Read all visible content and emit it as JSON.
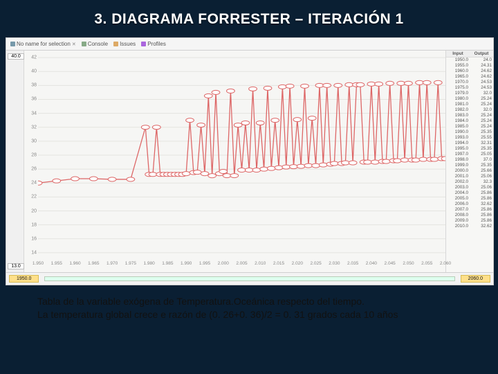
{
  "slide": {
    "title": "3. DIAGRAMA FORRESTER – ITERACIÓN 1"
  },
  "toolbar": {
    "tab1": "No name for selection",
    "console": "Console",
    "issues": "Issues",
    "profiles": "Profiles"
  },
  "edge": {
    "top_left": "40.0",
    "bottom_left": "13.0"
  },
  "slider": {
    "start": "1950.0",
    "end": "2060.0"
  },
  "table_head": {
    "input": "Input",
    "output": "Output"
  },
  "caption": {
    "l1": "Tabla de la variable exógena de Temperatura.Oceánica respecto del tiempo.",
    "l2": "La temperatura global crece e razón de (0. 26+0. 36)/2 = 0. 31 grados cada 10 años"
  },
  "chart_data": {
    "type": "line",
    "title": "",
    "xlabel": "",
    "ylabel": "",
    "xlim": [
      1950,
      2060
    ],
    "ylim": [
      13,
      43
    ],
    "y_ticks": [
      14,
      16,
      18,
      20,
      22,
      24,
      26,
      28,
      30,
      32,
      34,
      36,
      38,
      40,
      42
    ],
    "x_ticks": [
      1950,
      1955,
      1960,
      1965,
      1970,
      1975,
      1980,
      1985,
      1990,
      1995,
      2000,
      2005,
      2010,
      2015,
      2020,
      2025,
      2030,
      2035,
      2040,
      2045,
      2050,
      2055,
      2060
    ],
    "series": [
      {
        "name": "Temperatura.Oceánica",
        "points": [
          [
            1950,
            24.0
          ],
          [
            1955,
            24.31
          ],
          [
            1960,
            24.62
          ],
          [
            1965,
            24.62
          ],
          [
            1970,
            24.53
          ],
          [
            1975,
            24.53
          ],
          [
            1979,
            32.0
          ],
          [
            1980,
            25.24
          ],
          [
            1981,
            25.24
          ],
          [
            1982,
            32.0
          ],
          [
            1983,
            25.24
          ],
          [
            1984,
            25.24
          ],
          [
            1985,
            25.24
          ],
          [
            1986,
            25.24
          ],
          [
            1987,
            25.24
          ],
          [
            1988,
            25.24
          ],
          [
            1989,
            25.24
          ],
          [
            1990,
            25.35
          ],
          [
            1991,
            33.0
          ],
          [
            1992,
            25.5
          ],
          [
            1993,
            25.55
          ],
          [
            1994,
            32.31
          ],
          [
            1995,
            25.35
          ],
          [
            1996,
            36.5
          ],
          [
            1997,
            25.05
          ],
          [
            1998,
            37.0
          ],
          [
            1999,
            25.35
          ],
          [
            2000,
            25.66
          ],
          [
            2001,
            25.06
          ],
          [
            2002,
            37.2
          ],
          [
            2003,
            25.06
          ],
          [
            2004,
            32.31
          ],
          [
            2005,
            25.86
          ],
          [
            2006,
            32.62
          ],
          [
            2007,
            25.86
          ],
          [
            2008,
            37.5
          ],
          [
            2009,
            25.86
          ],
          [
            2010,
            32.62
          ],
          [
            2011,
            26.0
          ],
          [
            2012,
            37.6
          ],
          [
            2013,
            26.1
          ],
          [
            2014,
            33.0
          ],
          [
            2015,
            26.2
          ],
          [
            2016,
            37.8
          ],
          [
            2017,
            26.3
          ],
          [
            2018,
            37.9
          ],
          [
            2019,
            26.35
          ],
          [
            2020,
            33.1
          ],
          [
            2021,
            26.4
          ],
          [
            2022,
            37.9
          ],
          [
            2023,
            26.5
          ],
          [
            2024,
            33.3
          ],
          [
            2025,
            26.5
          ],
          [
            2026,
            38.0
          ],
          [
            2027,
            26.6
          ],
          [
            2028,
            38.0
          ],
          [
            2029,
            26.7
          ],
          [
            2030,
            26.8
          ],
          [
            2031,
            38.0
          ],
          [
            2032,
            26.8
          ],
          [
            2033,
            26.9
          ],
          [
            2034,
            38.1
          ],
          [
            2035,
            26.9
          ],
          [
            2036,
            38.1
          ],
          [
            2037,
            38.1
          ],
          [
            2038,
            27.0
          ],
          [
            2039,
            27.0
          ],
          [
            2040,
            38.2
          ],
          [
            2041,
            27.0
          ],
          [
            2042,
            38.2
          ],
          [
            2043,
            27.1
          ],
          [
            2044,
            27.1
          ],
          [
            2045,
            38.3
          ],
          [
            2046,
            27.2
          ],
          [
            2047,
            27.2
          ],
          [
            2048,
            38.3
          ],
          [
            2049,
            27.3
          ],
          [
            2050,
            38.3
          ],
          [
            2051,
            27.3
          ],
          [
            2052,
            27.3
          ],
          [
            2053,
            38.4
          ],
          [
            2054,
            27.4
          ],
          [
            2055,
            38.4
          ],
          [
            2056,
            27.4
          ],
          [
            2057,
            27.4
          ],
          [
            2058,
            38.4
          ],
          [
            2059,
            27.5
          ],
          [
            2060,
            27.5
          ]
        ]
      }
    ]
  },
  "table_rows": [
    [
      "1950.0",
      "24.0"
    ],
    [
      "1955.0",
      "24.31"
    ],
    [
      "1960.0",
      "24.62"
    ],
    [
      "1965.0",
      "24.62"
    ],
    [
      "1970.0",
      "24.53"
    ],
    [
      "1975.0",
      "24.53"
    ],
    [
      "1979.0",
      "32.0"
    ],
    [
      "1980.0",
      "25.24"
    ],
    [
      "1981.0",
      "25.24"
    ],
    [
      "1982.0",
      "32.0"
    ],
    [
      "1983.0",
      "25.24"
    ],
    [
      "1984.0",
      "25.24"
    ],
    [
      "1985.0",
      "25.24"
    ],
    [
      "1990.0",
      "25.35"
    ],
    [
      "1993.0",
      "25.55"
    ],
    [
      "1994.0",
      "32.31"
    ],
    [
      "1995.0",
      "25.35"
    ],
    [
      "1997.0",
      "25.05"
    ],
    [
      "1998.0",
      "37.0"
    ],
    [
      "1999.0",
      "25.35"
    ],
    [
      "2000.0",
      "25.66"
    ],
    [
      "2001.0",
      "25.06"
    ],
    [
      "2002.0",
      "32.3"
    ],
    [
      "2003.0",
      "25.06"
    ],
    [
      "2004.0",
      "25.86"
    ],
    [
      "2005.0",
      "25.86"
    ],
    [
      "2006.0",
      "32.62"
    ],
    [
      "2007.0",
      "25.86"
    ],
    [
      "2008.0",
      "25.86"
    ],
    [
      "2009.0",
      "25.86"
    ],
    [
      "2010.0",
      "32.62"
    ]
  ]
}
